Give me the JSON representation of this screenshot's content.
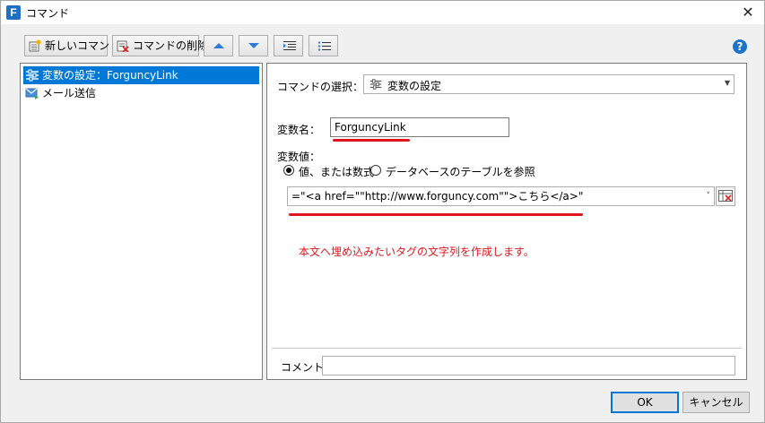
{
  "window": {
    "title": "コマンド",
    "app_icon_letter": "F",
    "close_glyph": "✕"
  },
  "toolbar": {
    "new_command": "新しいコマンド",
    "delete_command": "コマンドの削除"
  },
  "icons": {
    "help_glyph": "?"
  },
  "tree": {
    "items": [
      {
        "label": "変数の設定：ForguncyLink",
        "icon": "variable-set-icon"
      },
      {
        "label": "メール送信",
        "icon": "mail-icon"
      }
    ]
  },
  "props": {
    "command_select_label": "コマンドの選択：",
    "command_selected": "変数の設定",
    "variable_name_label": "変数名：",
    "variable_name_value": "ForguncyLink",
    "variable_value_label": "変数値：",
    "radio_options": [
      {
        "label": "値、または数式",
        "checked": true
      },
      {
        "label": "データベースのテーブルを参照",
        "checked": false
      }
    ],
    "formula_value": "=\"<a href=\"\"http://www.forguncy.com\"\">こちら</a>\"",
    "annotation": "本文へ埋め込みたいタグの文字列を作成します。",
    "comment_label": "コメント",
    "comment_value": ""
  },
  "footer": {
    "ok_label": "OK",
    "cancel_label": "キャンセル"
  },
  "colors": {
    "accent": "#0078d7",
    "annotation_red": "#e0161f"
  }
}
